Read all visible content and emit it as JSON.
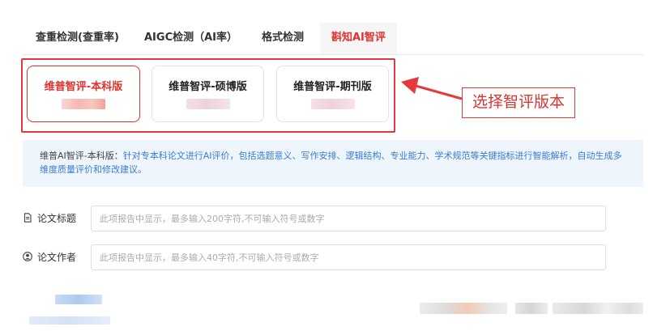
{
  "tabs": [
    {
      "label": "查重检测(查重率)"
    },
    {
      "label": "AIGC检测（AI率）"
    },
    {
      "label": "格式检测"
    },
    {
      "label": "斟知AI智评",
      "active": true
    }
  ],
  "versions": [
    {
      "label": "维普智评-本科版",
      "selected": true
    },
    {
      "label": "维普智评-硕博版",
      "selected": false
    },
    {
      "label": "维普智评-期刊版",
      "selected": false
    }
  ],
  "callout": {
    "text": "选择智评版本"
  },
  "description": {
    "label": "维普AI智评-本科版：",
    "text": "针对专本科论文进行AI评价，包括选题意义、写作安排、逻辑结构、专业能力、学术规范等关键指标进行智能解析，自动生成多维度质量评价和修改建议。"
  },
  "form": {
    "title": {
      "label": "论文标题",
      "placeholder": "此项报告中显示，最多输入200字符,不可输入符号或数字",
      "value": ""
    },
    "author": {
      "label": "论文作者",
      "placeholder": "此项报告中显示，最多输入40字符,不可输入符号或数字",
      "value": ""
    }
  },
  "colors": {
    "accent": "#e0332f",
    "info_text": "#3a7bd5",
    "info_bg": "#eef5fd"
  },
  "icons": {
    "title": "document-icon",
    "author": "user-icon"
  }
}
